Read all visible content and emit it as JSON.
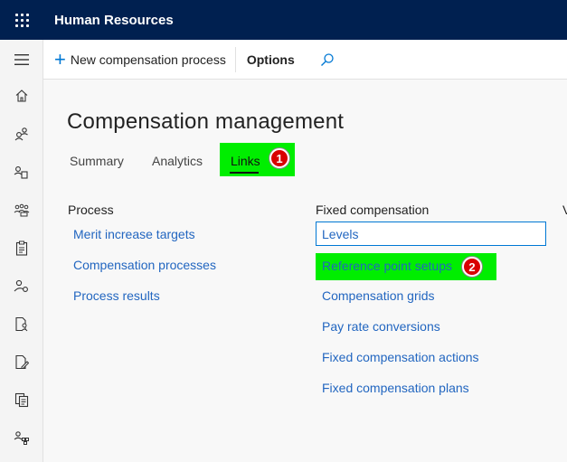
{
  "app": {
    "title": "Human Resources"
  },
  "actions": {
    "new_label": "New compensation process",
    "options_label": "Options"
  },
  "page": {
    "title": "Compensation management"
  },
  "tabs": [
    {
      "label": "Summary",
      "selected": false
    },
    {
      "label": "Analytics",
      "selected": false
    },
    {
      "label": "Links",
      "selected": true
    }
  ],
  "annotations": [
    {
      "number": "1",
      "color": "#d90000"
    },
    {
      "number": "2",
      "color": "#d90000"
    }
  ],
  "highlight_color": "#00ee00",
  "columns": {
    "process": {
      "header": "Process",
      "links": [
        "Merit increase targets",
        "Compensation processes",
        "Process results"
      ]
    },
    "fixed": {
      "header": "Fixed compensation",
      "links": [
        "Levels",
        "Reference point setups",
        "Compensation grids",
        "Pay rate conversions",
        "Fixed compensation actions",
        "Fixed compensation plans"
      ]
    },
    "cut_off_header": "V"
  },
  "nav_icons": [
    "hamburger-icon",
    "home-icon",
    "people-icon",
    "person-document-icon",
    "team-icon",
    "clipboard-icon",
    "person-settings-icon",
    "document-person-icon",
    "document-edit-icon",
    "documents-icon",
    "org-chart-icon"
  ]
}
